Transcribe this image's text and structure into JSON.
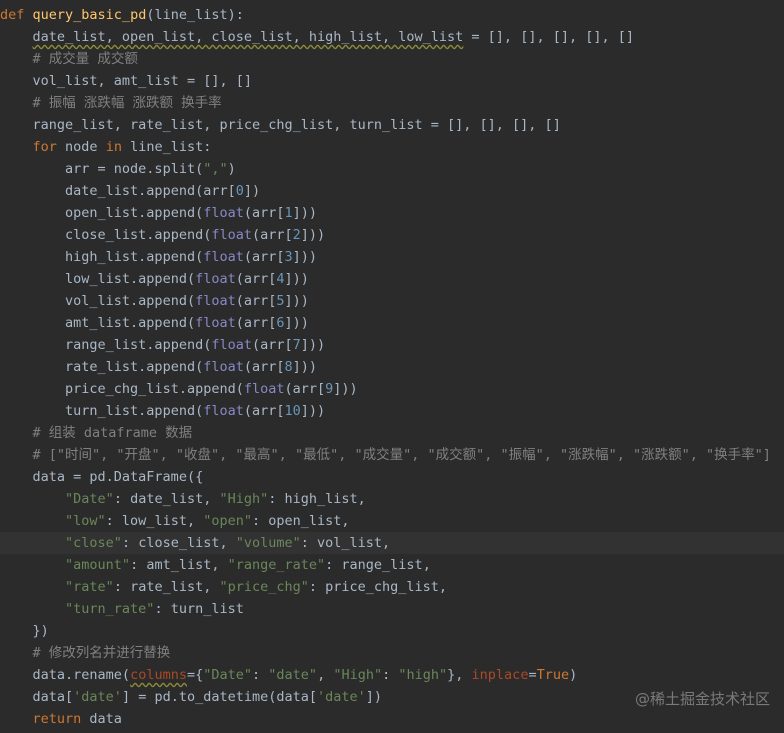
{
  "code": {
    "def_kw": "def",
    "func_name": "query_basic_pd",
    "func_params": "(line_list):",
    "l2": {
      "targets": "date_list, open_list, close_list, high_list, low_list",
      "rest": " = [], [], [], [], []"
    },
    "l3_comment": "# 成交量 成交额",
    "l4": "vol_list, amt_list = [], []",
    "l5_comment": "# 振幅 涨跌幅 涨跌额 换手率",
    "l6": "range_list, rate_list, price_chg_list, turn_list = [], [], [], []",
    "for_kw": "for",
    "for_var": " node ",
    "in_kw": "in",
    "for_rest": " line_list:",
    "split_pre": "arr = node.split(",
    "split_arg": "\",\"",
    "split_post": ")",
    "date_pre": "date_list.append(arr[",
    "date_idx": "0",
    "date_post": "])",
    "float_kw": "float",
    "appends": [
      {
        "pre": "open_list.append(",
        "mid": "(arr[",
        "idx": "1",
        "post": "]))"
      },
      {
        "pre": "close_list.append(",
        "mid": "(arr[",
        "idx": "2",
        "post": "]))"
      },
      {
        "pre": "high_list.append(",
        "mid": "(arr[",
        "idx": "3",
        "post": "]))"
      },
      {
        "pre": "low_list.append(",
        "mid": "(arr[",
        "idx": "4",
        "post": "]))"
      },
      {
        "pre": "vol_list.append(",
        "mid": "(arr[",
        "idx": "5",
        "post": "]))"
      },
      {
        "pre": "amt_list.append(",
        "mid": "(arr[",
        "idx": "6",
        "post": "]))"
      },
      {
        "pre": "range_list.append(",
        "mid": "(arr[",
        "idx": "7",
        "post": "]))"
      },
      {
        "pre": "rate_list.append(",
        "mid": "(arr[",
        "idx": "8",
        "post": "]))"
      },
      {
        "pre": "price_chg_list.append(",
        "mid": "(arr[",
        "idx": "9",
        "post": "]))"
      },
      {
        "pre": "turn_list.append(",
        "mid": "(arr[",
        "idx": "10",
        "post": "]))"
      }
    ],
    "c_assemble": "# 组装 dataframe 数据",
    "c_headers": "# [\"时间\", \"开盘\", \"收盘\", \"最高\", \"最低\", \"成交量\", \"成交额\", \"振幅\", \"涨跌幅\", \"涨跌额\", \"换手率\"]",
    "df_open": "data = pd.DataFrame({",
    "s_Date": "\"Date\"",
    "v_date_list": ": date_list, ",
    "s_High": "\"High\"",
    "v_high_list": ": high_list,",
    "s_low": "\"low\"",
    "v_low_list": ": low_list, ",
    "s_open": "\"open\"",
    "v_open_list": ": open_list,",
    "s_close": "\"close\"",
    "v_close_list": ": close_list, ",
    "s_volume": "\"volume\"",
    "v_vol_list": ": vol_list,",
    "s_amount": "\"amount\"",
    "v_amt_list": ": amt_list, ",
    "s_range_rate": "\"range_rate\"",
    "v_range_list": ": range_list,",
    "s_rate": "\"rate\"",
    "v_rate_list": ": rate_list, ",
    "s_price_chg": "\"price_chg\"",
    "v_price_chg_list": ": price_chg_list,",
    "s_turn_rate": "\"turn_rate\"",
    "v_turn_list": ": turn_list",
    "df_close": "})",
    "c_rename": "# 修改列名并进行替换",
    "rename_pre": "data.rename(",
    "rename_param": "columns",
    "rename_eq": "={",
    "s_Date2": "\"Date\"",
    "colon1": ": ",
    "s_date2": "\"date\"",
    "comma1": ", ",
    "s_High2": "\"High\"",
    "colon2": ": ",
    "s_high2": "\"high\"",
    "brace_close": "}, ",
    "inplace_param": "inplace",
    "inplace_eq": "=",
    "true_kw": "True",
    "rename_end": ")",
    "dt_pre": "data[",
    "s_date3": "'date'",
    "dt_mid": "] = pd.to_datetime(data[",
    "s_date4": "'date'",
    "dt_post": "])",
    "return_kw": "return",
    "return_val": " data"
  },
  "watermark": "@稀土掘金技术社区"
}
